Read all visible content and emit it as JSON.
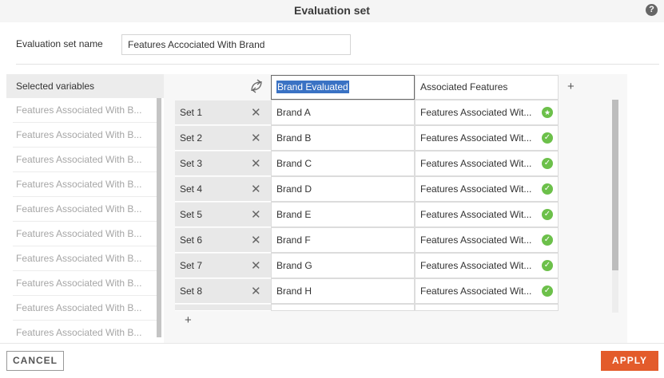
{
  "dialog": {
    "title": "Evaluation set",
    "help_icon": "?"
  },
  "name_field": {
    "label": "Evaluation set name",
    "value": "Features Accociated With Brand"
  },
  "left_panel": {
    "header": "Selected variables",
    "items": [
      "Features Associated With B...",
      "Features Associated With B...",
      "Features Associated With B...",
      "Features Associated With B...",
      "Features Associated With B...",
      "Features Associated With B...",
      "Features Associated With B...",
      "Features Associated With B...",
      "Features Associated With B...",
      "Features Associated With B..."
    ]
  },
  "grid": {
    "columns": [
      "Brand Evaluated",
      "Associated Features"
    ],
    "add_column_icon": "+",
    "add_row_icon": "+",
    "remove_icon": "✕",
    "rows": [
      {
        "label": "Set 1",
        "brand": "Brand A",
        "feature": "Features Associated Wit...",
        "status": "star"
      },
      {
        "label": "Set 2",
        "brand": "Brand B",
        "feature": "Features Associated Wit...",
        "status": "check"
      },
      {
        "label": "Set 3",
        "brand": "Brand C",
        "feature": "Features Associated Wit...",
        "status": "check"
      },
      {
        "label": "Set 4",
        "brand": "Brand D",
        "feature": "Features Associated Wit...",
        "status": "check"
      },
      {
        "label": "Set 5",
        "brand": "Brand E",
        "feature": "Features Associated Wit...",
        "status": "check"
      },
      {
        "label": "Set 6",
        "brand": "Brand F",
        "feature": "Features Associated Wit...",
        "status": "check"
      },
      {
        "label": "Set 7",
        "brand": "Brand G",
        "feature": "Features Associated Wit...",
        "status": "check"
      },
      {
        "label": "Set 8",
        "brand": "Brand H",
        "feature": "Features Associated Wit...",
        "status": "check"
      }
    ]
  },
  "footer": {
    "cancel_label": "CANCEL",
    "apply_label": "APPLY"
  },
  "colors": {
    "accent": "#e35b2b",
    "success": "#6cc04a",
    "selection": "#3a72c4"
  }
}
